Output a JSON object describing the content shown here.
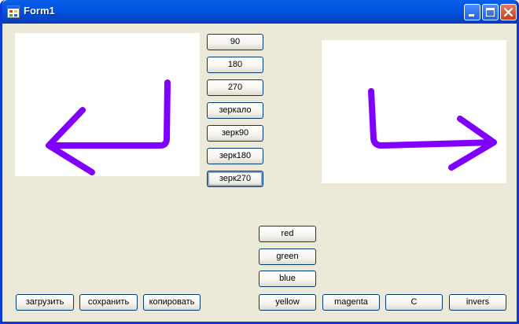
{
  "window": {
    "title": "Form1",
    "icon": "form-app-icon",
    "controls": {
      "minimize": "minimize-icon",
      "maximize": "maximize-icon",
      "close": "close-icon"
    }
  },
  "rotate_buttons": [
    "90",
    "180",
    "270",
    "зеркало",
    "зерк90",
    "зерк180",
    "зерк270"
  ],
  "color_buttons": {
    "red": "red",
    "green": "green",
    "blue": "blue"
  },
  "bottom_buttons": {
    "load": "загрузить",
    "save": "сохранить",
    "copy": "копировать",
    "yellow": "yellow",
    "magenta": "magenta",
    "c": "C",
    "invers": "invers"
  },
  "images": {
    "left": {
      "content": "arrow-left-icon"
    },
    "right": {
      "content": "arrow-right-icon"
    },
    "stroke_color": "#7f00ff"
  },
  "colors": {
    "title_bar": "#0053e0",
    "window_bg": "#ece9d8",
    "button_border": "#003c74"
  }
}
